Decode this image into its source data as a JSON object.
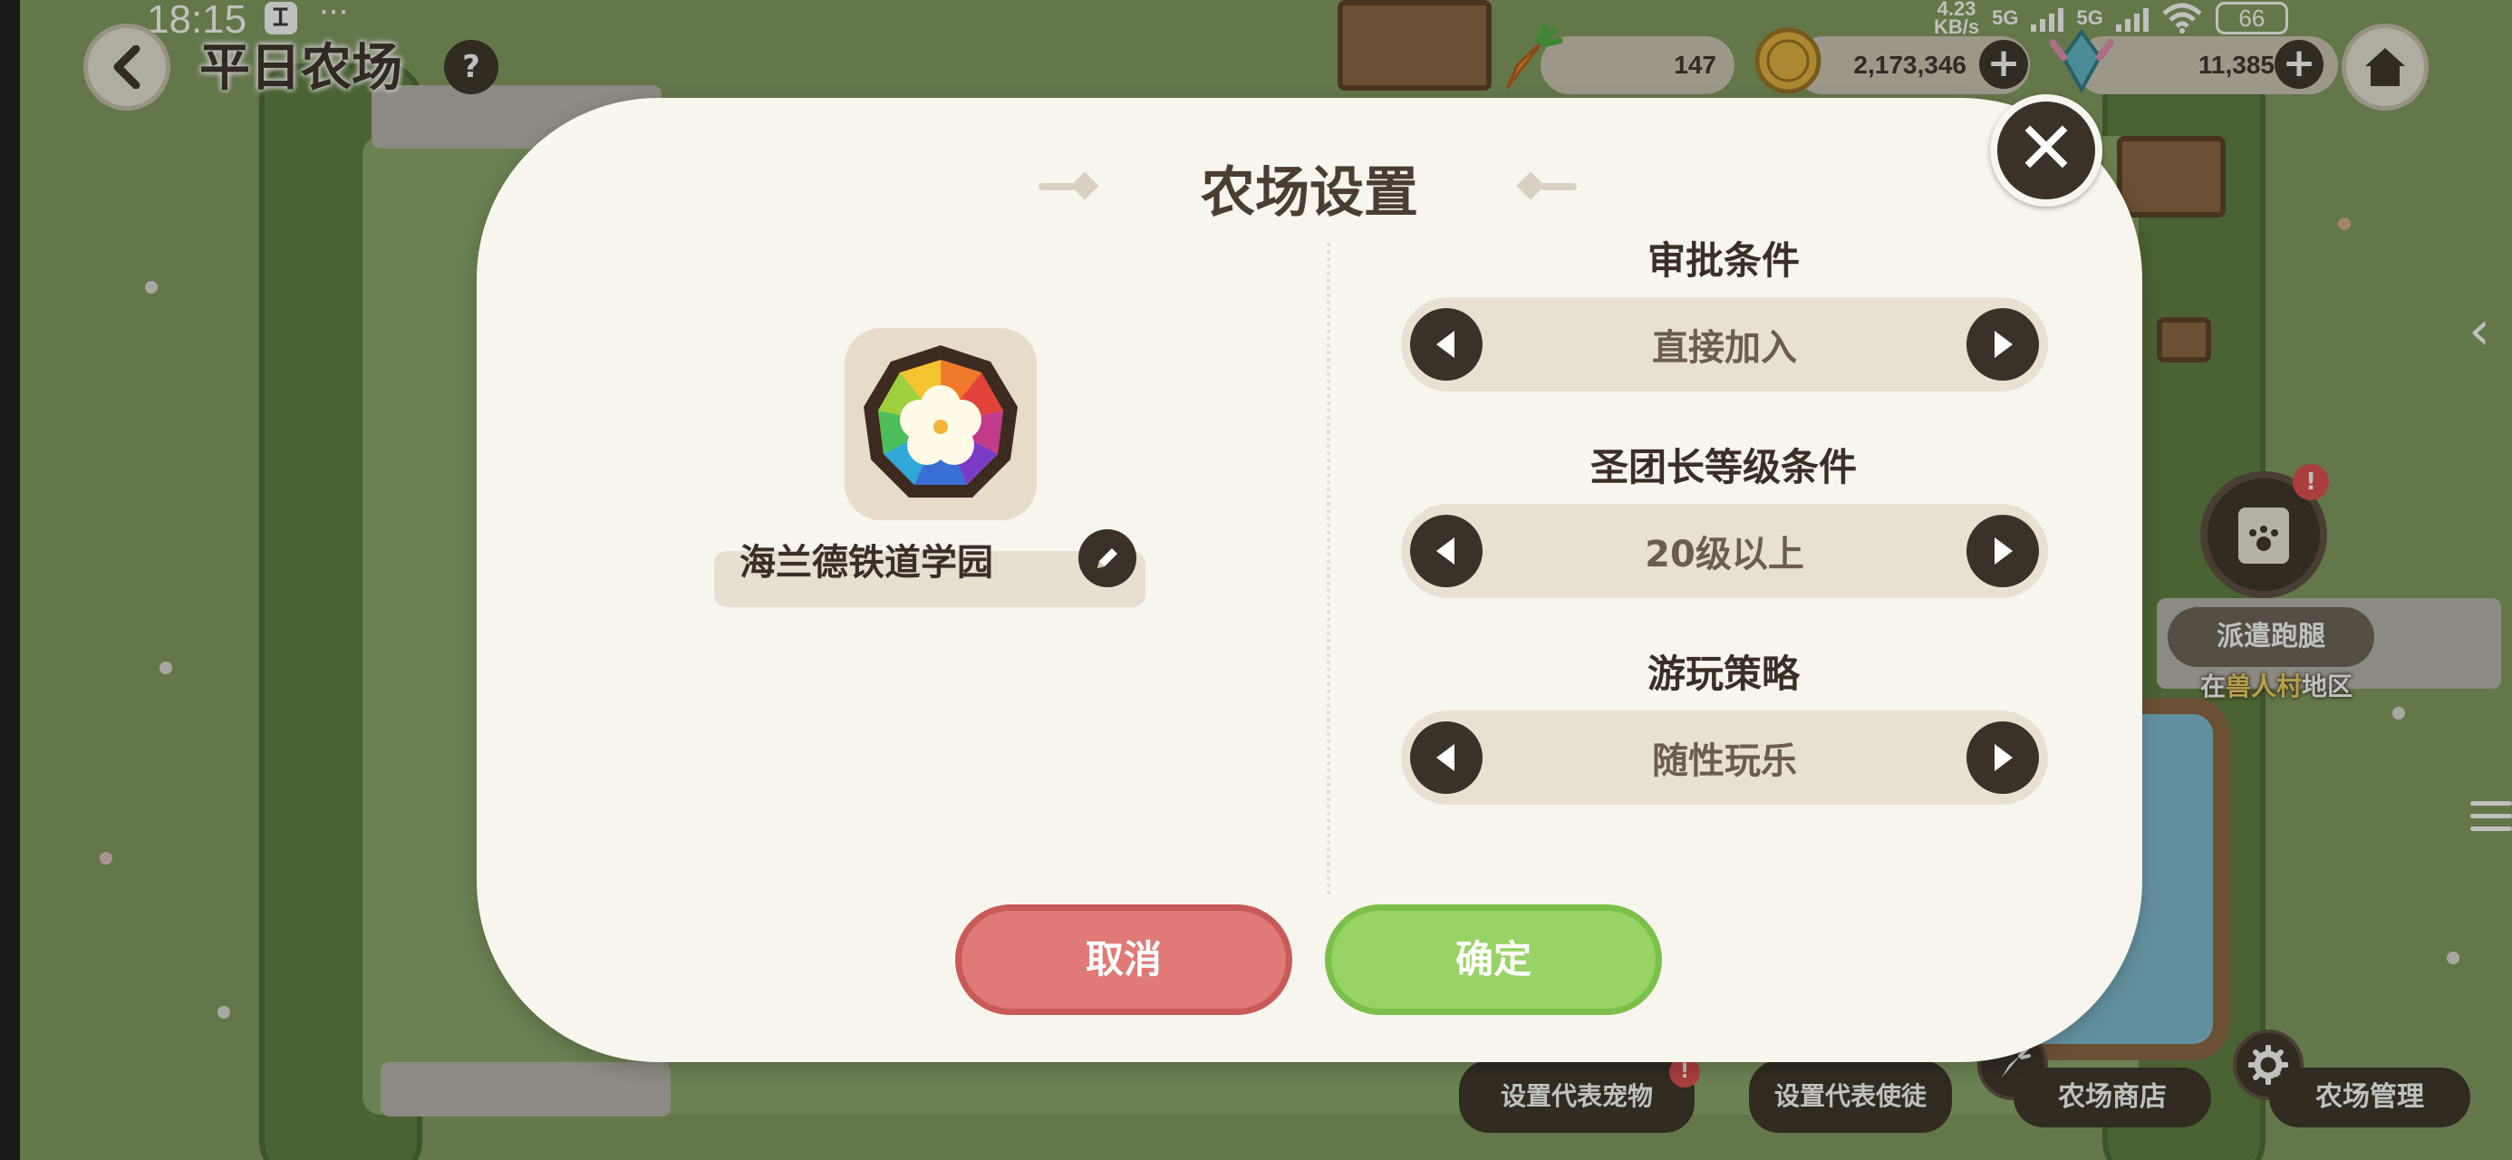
{
  "status_bar": {
    "time": "18:15",
    "app_icon_glyph": "Ꮖ",
    "dots": "···",
    "net_speed_value": "4.23",
    "net_speed_unit": "KB/s",
    "net_tag_1": "5G",
    "net_tag_2": "5G",
    "battery": "66"
  },
  "hud": {
    "farm_title": "平日农场",
    "help_glyph": "?",
    "carrots": "147",
    "coins": "2,173,346",
    "gems": "11,385",
    "plus": "+"
  },
  "modal": {
    "title": "农场设置",
    "close_glyph": "✕",
    "farm_name": "海兰德铁道学园",
    "settings": [
      {
        "label": "审批条件",
        "value": "直接加入"
      },
      {
        "label": "圣团长等级条件",
        "value": "20级以上"
      },
      {
        "label": "游玩策略",
        "value": "随性玩乐"
      }
    ],
    "cancel_label": "取消",
    "confirm_label": "确定"
  },
  "side": {
    "dispatch_label": "派遣跑腿",
    "dispatch_badge": "!",
    "dispatch_loc_prefix": "在",
    "dispatch_loc_highlight": "兽人村",
    "dispatch_loc_suffix": "地区",
    "arrow_glyph": "‹"
  },
  "bottom": {
    "rep_pet_label": "设置代表宠物",
    "rep_apostle_label": "设置代表使徒",
    "shop_label": "农场商店",
    "manage_label": "农场管理",
    "badge": "!"
  },
  "colors": {
    "modal_bg": "#f8f5ee",
    "dark": "#3a3128",
    "cancel": "#e07a76",
    "confirm": "#98d365"
  }
}
